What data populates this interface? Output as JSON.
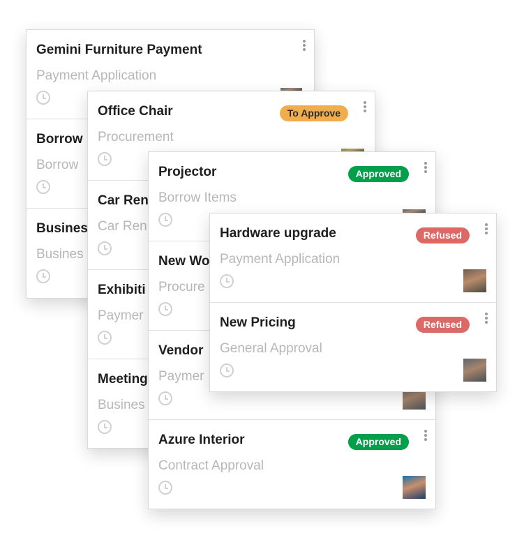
{
  "colors": {
    "to_approve": "#f0ad4e",
    "approved": "#00a04a",
    "refused": "#dc6965",
    "subtitle": "#b5b7bb"
  },
  "panels": [
    {
      "cards": [
        {
          "title": "Gemini Furniture Payment",
          "subtitle": "Payment Application"
        },
        {
          "title": "Borrow",
          "subtitle": "Borrow"
        },
        {
          "title": "Busines",
          "subtitle": "Busines"
        }
      ]
    },
    {
      "cards": [
        {
          "title": "Office Chair",
          "subtitle": "Procurement",
          "badge": "To Approve"
        },
        {
          "title": "Car Ren",
          "subtitle": "Car Ren"
        },
        {
          "title": "Exhibiti",
          "subtitle": "Paymer"
        },
        {
          "title": "Meeting",
          "subtitle": "Busines"
        }
      ]
    },
    {
      "cards": [
        {
          "title": "Projector",
          "subtitle": "Borrow Items",
          "badge": "Approved"
        },
        {
          "title": "New Wo",
          "subtitle": "Procure"
        },
        {
          "title": "Vendor",
          "subtitle": "Paymer"
        },
        {
          "title": "Azure Interior",
          "subtitle": "Contract Approval",
          "badge": "Approved"
        }
      ]
    },
    {
      "cards": [
        {
          "title": "Hardware upgrade",
          "subtitle": "Payment Application",
          "badge": "Refused"
        },
        {
          "title": "New Pricing",
          "subtitle": "General Approval",
          "badge": "Refused"
        }
      ]
    }
  ],
  "icons": [
    "clock-icon",
    "kebab-menu-icon",
    "avatar"
  ]
}
